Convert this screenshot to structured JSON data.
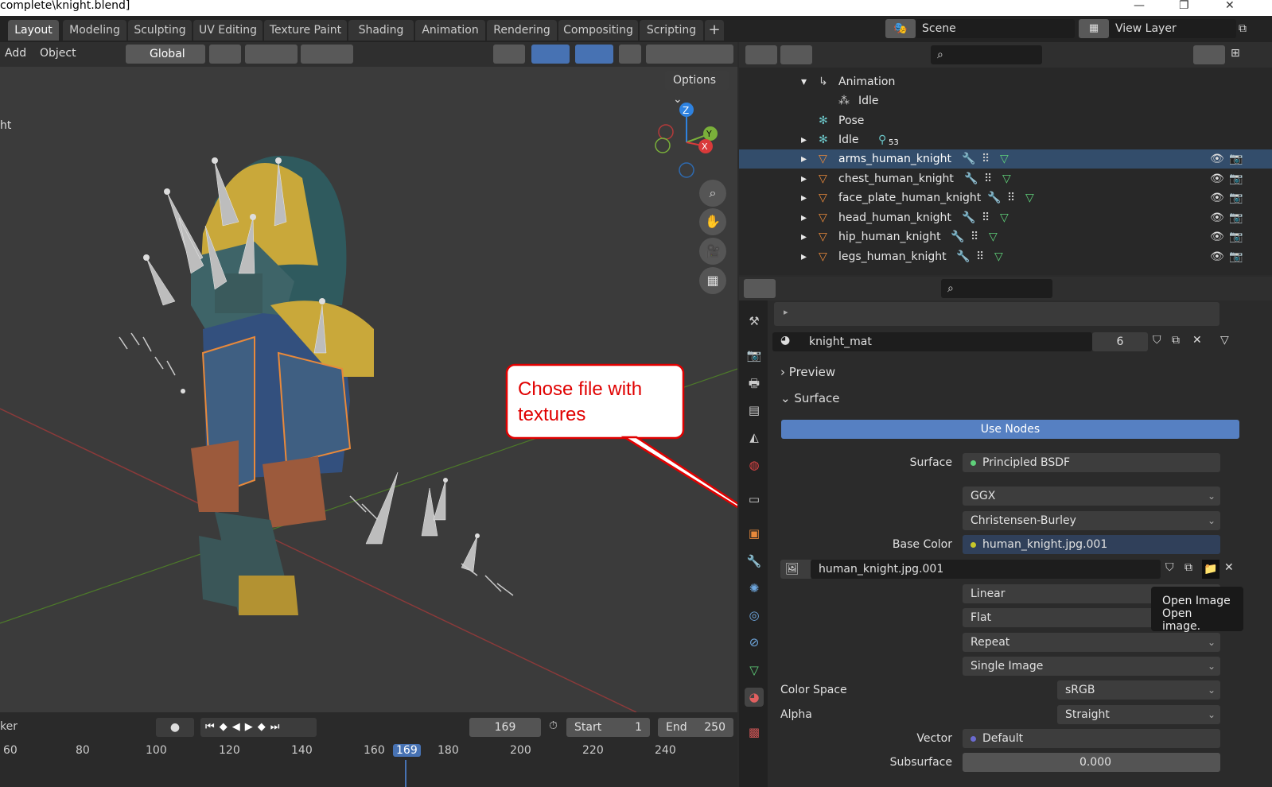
{
  "window": {
    "title": "complete\\knight.blend]"
  },
  "workspace_tabs": [
    "Layout",
    "Modeling",
    "Sculpting",
    "UV Editing",
    "Texture Paint",
    "Shading",
    "Animation",
    "Rendering",
    "Compositing",
    "Scripting"
  ],
  "scene": {
    "label": "Scene"
  },
  "view_layer": {
    "label": "View Layer"
  },
  "viewport_header": {
    "add": "Add",
    "object": "Object",
    "orientation": "Global"
  },
  "viewport": {
    "options": "Options",
    "side_text": "ht"
  },
  "gizmo": {
    "z": "Z",
    "y": "Y",
    "x": "X"
  },
  "callout": {
    "text_line1": "Chose file with",
    "text_line2": "textures"
  },
  "timeline": {
    "left_label": "ker",
    "current_frame": "169",
    "start_label": "Start",
    "start_value": "1",
    "end_label": "End",
    "end_value": "250",
    "ruler": [
      "60",
      "80",
      "100",
      "120",
      "140",
      "160",
      "169",
      "180",
      "200",
      "220",
      "240"
    ]
  },
  "outliner": {
    "rows": [
      {
        "label": "Animation"
      },
      {
        "label": "Idle"
      },
      {
        "label": "Pose"
      },
      {
        "label": "Idle",
        "badge": "53"
      },
      {
        "label": "arms_human_knight",
        "selected": true
      },
      {
        "label": "chest_human_knight"
      },
      {
        "label": "face_plate_human_knight"
      },
      {
        "label": "head_human_knight"
      },
      {
        "label": "hip_human_knight"
      },
      {
        "label": "legs_human_knight"
      }
    ]
  },
  "properties": {
    "material_name": "knight_mat",
    "material_users": "6",
    "preview_label": "Preview",
    "surface_panel_label": "Surface",
    "use_nodes": "Use Nodes",
    "surface_label": "Surface",
    "surface_value": "Principled BSDF",
    "distribution": "GGX",
    "subsurface_method": "Christensen-Burley",
    "base_color_label": "Base Color",
    "base_color_value": "human_knight.jpg.001",
    "image_name": "human_knight.jpg.001",
    "interpolation": "Linear",
    "projection": "Flat",
    "extension": "Repeat",
    "source": "Single Image",
    "color_space_label": "Color Space",
    "color_space_value": "sRGB",
    "alpha_label": "Alpha",
    "alpha_value": "Straight",
    "vector_label": "Vector",
    "vector_value": "Default",
    "subsurface_label": "Subsurface",
    "subsurface_value": "0.000",
    "tooltip_line1": "Open Image",
    "tooltip_line2": "Open image."
  },
  "colors": {
    "accent": "#4772b3",
    "selection": "#334d6b",
    "callout_border": "#e00000",
    "object_orange": "#e8893b"
  }
}
